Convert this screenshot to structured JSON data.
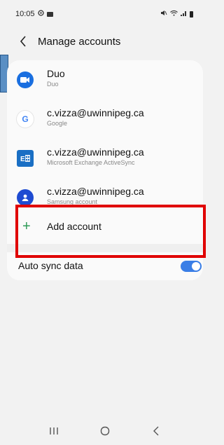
{
  "status_bar": {
    "time": "10:05"
  },
  "header": {
    "title": "Manage accounts"
  },
  "accounts": [
    {
      "name": "Duo",
      "type": "Duo",
      "icon": "duo-video-icon",
      "color": "#1a6fe0"
    },
    {
      "name": "c.vizza@uwinnipeg.ca",
      "type": "Google",
      "icon": "google-g-icon",
      "color": "#4285f4"
    },
    {
      "name": "c.vizza@uwinnipeg.ca",
      "type": "Microsoft Exchange ActiveSync",
      "icon": "exchange-icon",
      "color": "#1a6fc4"
    },
    {
      "name": "c.vizza@uwinnipeg.ca",
      "type": "Samsung account",
      "icon": "samsung-account-icon",
      "color": "#1e4bd2"
    }
  ],
  "add_account": {
    "label": "Add account"
  },
  "sync": {
    "label": "Auto sync data",
    "enabled": true
  },
  "colors": {
    "accent": "#3a7ee6",
    "plus": "#2e9b57",
    "highlight": "#e00000"
  }
}
